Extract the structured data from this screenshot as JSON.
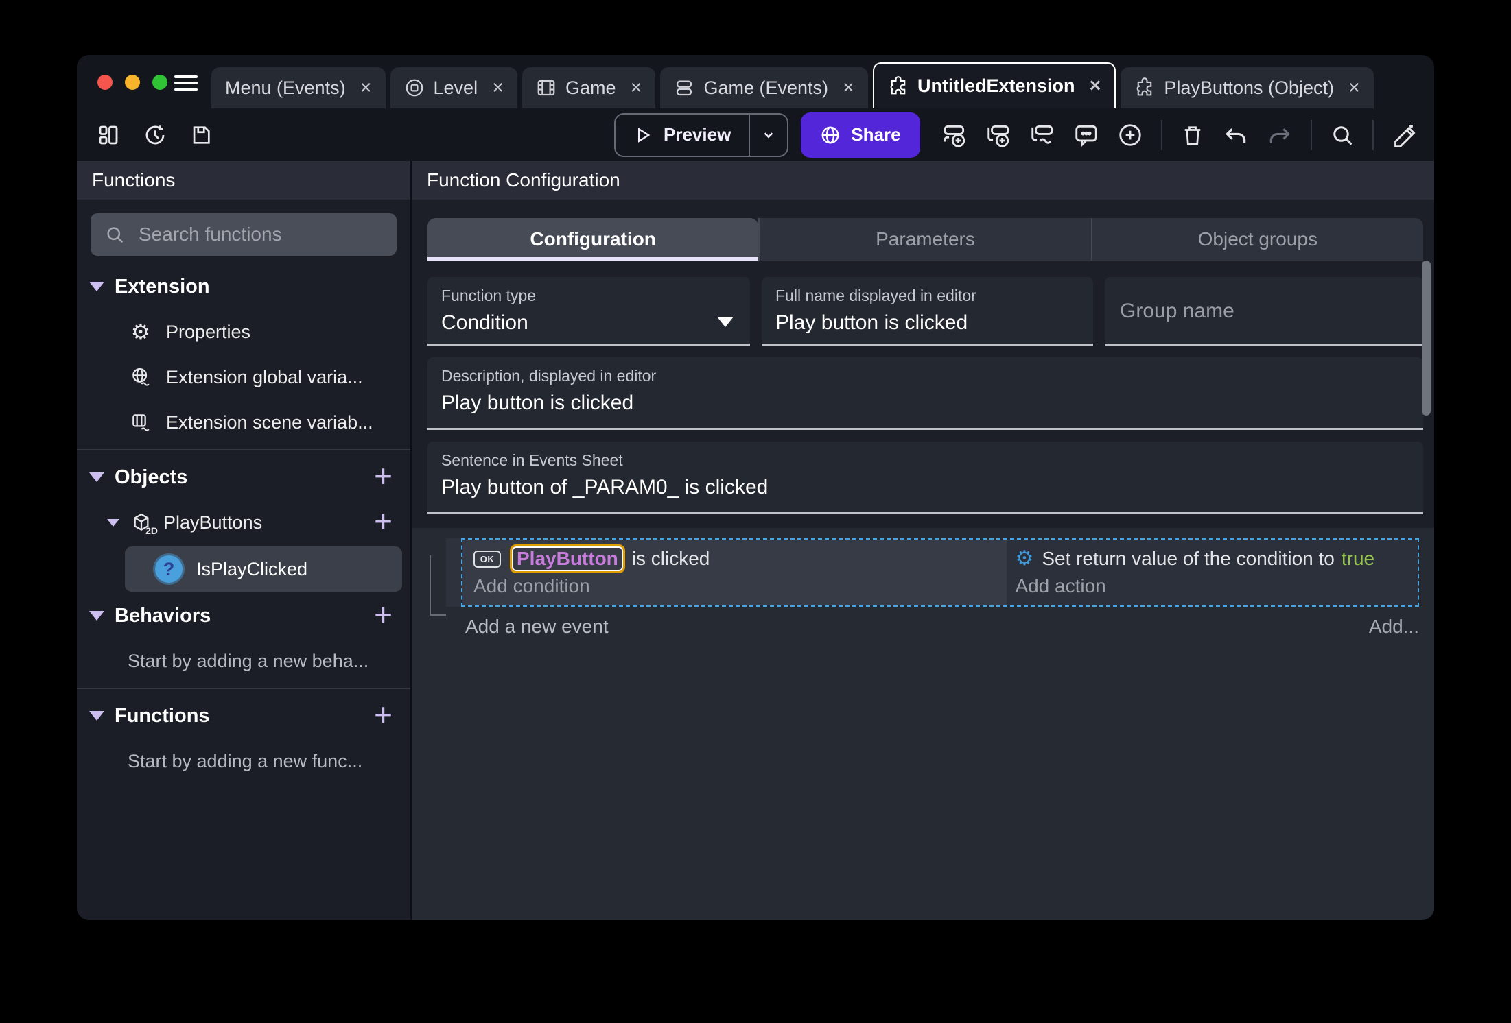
{
  "icons": {
    "close_glyph": "×",
    "plus_glyph": "+",
    "gear_glyph": "⚙",
    "cube_badge": "2D",
    "ok_badge": "OK"
  },
  "window_tabs": {
    "tabs": [
      {
        "label": "Menu (Events)"
      },
      {
        "label": "Level"
      },
      {
        "label": "Game"
      },
      {
        "label": "Game (Events)"
      },
      {
        "label": "UntitledExtension"
      },
      {
        "label": "PlayButtons (Object)"
      }
    ]
  },
  "toolbar": {
    "preview_label": "Preview",
    "share_label": "Share"
  },
  "sidebar": {
    "header": "Functions",
    "search_placeholder": "Search functions",
    "extension_section": {
      "label": "Extension"
    },
    "extension_items": [
      {
        "label": "Properties"
      },
      {
        "label": "Extension global varia..."
      },
      {
        "label": "Extension scene variab..."
      }
    ],
    "objects_section": {
      "label": "Objects"
    },
    "playbuttons_item": {
      "label": "PlayButtons"
    },
    "selected_function": {
      "label": "IsPlayClicked",
      "icon_glyph": "?"
    },
    "behaviors_section": {
      "label": "Behaviors",
      "empty_hint": "Start by adding a new beha..."
    },
    "functions_section": {
      "label": "Functions",
      "empty_hint": "Start by adding a new func..."
    }
  },
  "main": {
    "header": "Function Configuration",
    "tabs": [
      {
        "label": "Configuration"
      },
      {
        "label": "Parameters"
      },
      {
        "label": "Object groups"
      }
    ],
    "fields": {
      "function_type": {
        "label": "Function type",
        "value": "Condition"
      },
      "full_name": {
        "label": "Full name displayed in editor",
        "value": "Play button is clicked"
      },
      "group_name": {
        "placeholder": "Group name"
      },
      "description": {
        "label": "Description, displayed in editor",
        "value": "Play button is clicked"
      },
      "sentence": {
        "label": "Sentence in Events Sheet",
        "value": "Play button of _PARAM0_ is clicked"
      }
    },
    "events_sheet": {
      "condition_object": "PlayButton",
      "condition_text": "is clicked",
      "add_condition": "Add condition",
      "action_text": "Set return value of the condition to",
      "action_value": "true",
      "add_action": "Add action",
      "add_event": "Add a new event",
      "add_more": "Add..."
    }
  },
  "colors": {
    "accent_purple": "#5426d9",
    "accent_lavender": "#cdbef0",
    "tab_underline": "#e7e1f9",
    "selected_event_border": "#4aa3dc",
    "object_highlight_border": "#e09d00",
    "object_text": "#c77cdb",
    "boolean_true": "#94c24e",
    "action_icon_blue": "#3f9bd9",
    "function_icon_blue": "#4aa0dc",
    "sidebar_bg": "#1b1e26",
    "main_bg": "#1c1f27",
    "events_bg": "#262a33"
  }
}
